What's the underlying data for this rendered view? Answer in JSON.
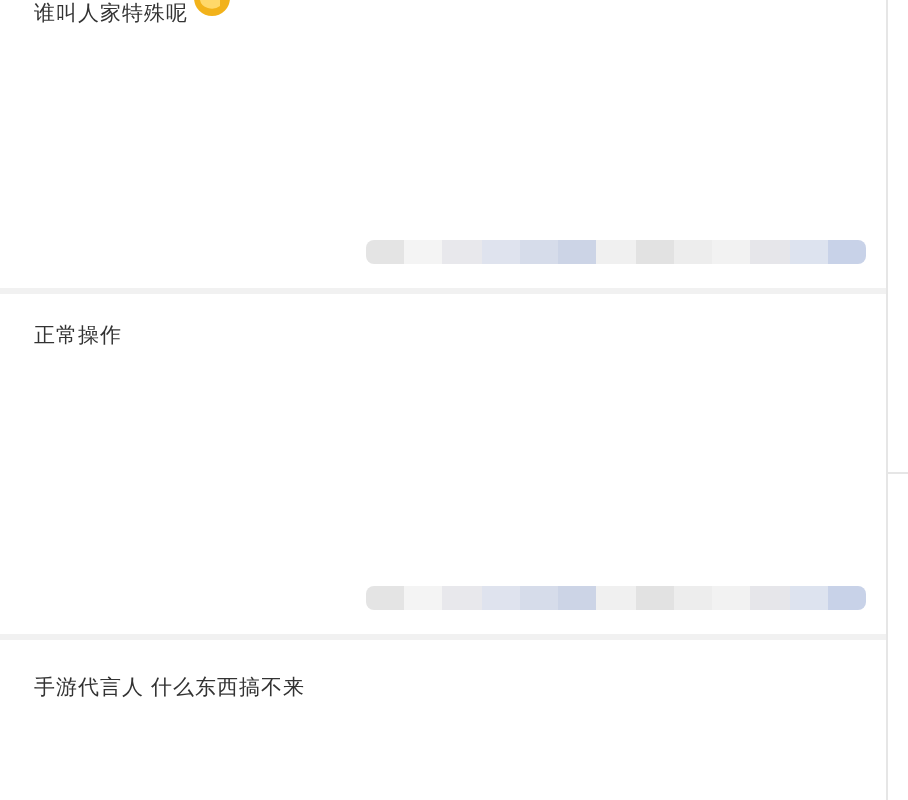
{
  "comments": [
    {
      "text": "谁叫人家特殊呢",
      "emoji": true
    },
    {
      "text": "正常操作",
      "emoji": false
    },
    {
      "text": "手游代言人 什么东西搞不来",
      "emoji": false
    }
  ]
}
